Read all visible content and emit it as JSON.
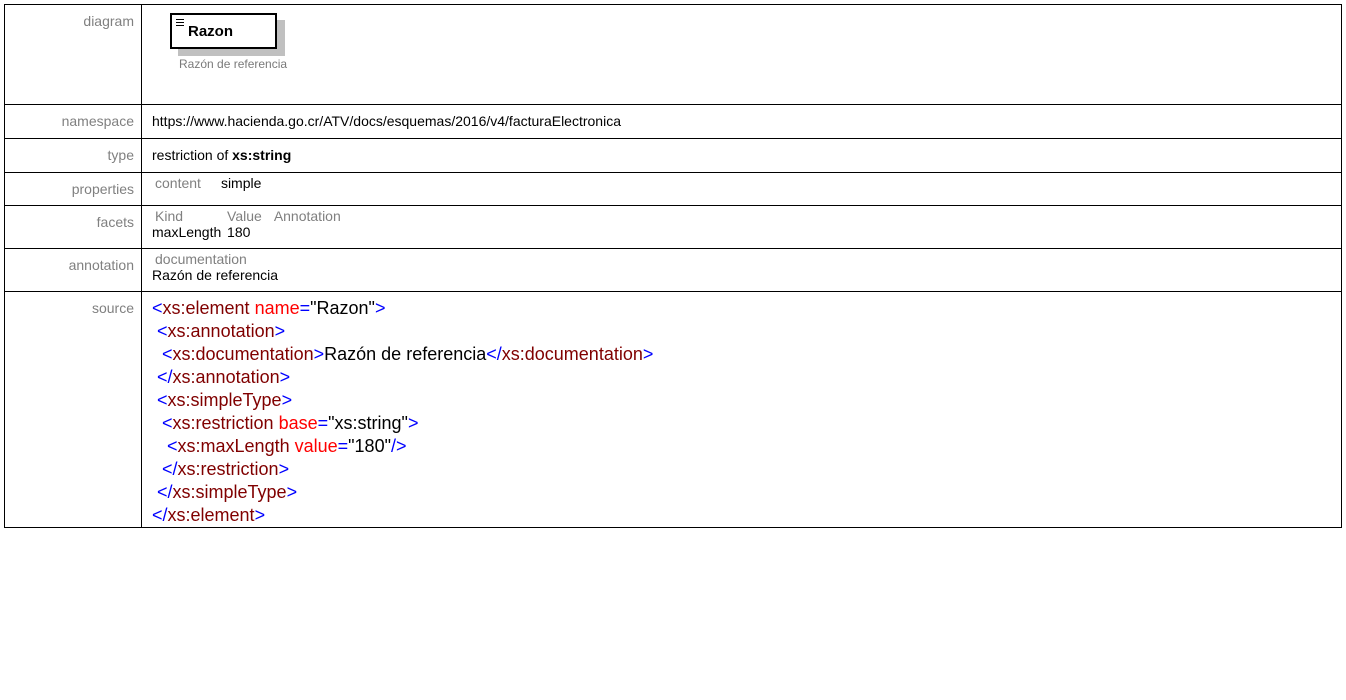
{
  "labels": {
    "diagram": "diagram",
    "namespace": "namespace",
    "type": "type",
    "properties": "properties",
    "facets": "facets",
    "annotation": "annotation",
    "source": "source"
  },
  "diagram": {
    "element_name": "Razon",
    "doc_caption": "Razón de referencia"
  },
  "namespace": "https://www.hacienda.go.cr/ATV/docs/esquemas/2016/v4/facturaElectronica",
  "type": {
    "prefix": "restriction of ",
    "base": "xs:string"
  },
  "properties": {
    "key": "content",
    "value": "simple"
  },
  "facets": {
    "headers": [
      "Kind",
      "Value",
      "Annotation"
    ],
    "rows": [
      {
        "kind": "maxLength",
        "value": "180",
        "annotation": ""
      }
    ]
  },
  "annotation": {
    "key": "documentation",
    "value": "Razón de referencia"
  },
  "source": {
    "l1_el": "xs:element",
    "l1_attr": "name",
    "l1_val": "\"Razon\"",
    "l2_el": "xs:annotation",
    "l3_el": "xs:documentation",
    "l3_text": "Razón de referencia",
    "l3_close": "xs:documentation",
    "l4_el": "xs:annotation",
    "l5_el": "xs:simpleType",
    "l6_el": "xs:restriction",
    "l6_attr": "base",
    "l6_val": "\"xs:string\"",
    "l7_el": "xs:maxLength",
    "l7_attr": "value",
    "l7_val": "\"180\"",
    "l8_el": "xs:restriction",
    "l9_el": "xs:simpleType",
    "l10_el": "xs:element"
  },
  "colors": {
    "tag": "#0000ff",
    "element": "#800000",
    "attribute": "#ff0000",
    "label": "#808080"
  }
}
